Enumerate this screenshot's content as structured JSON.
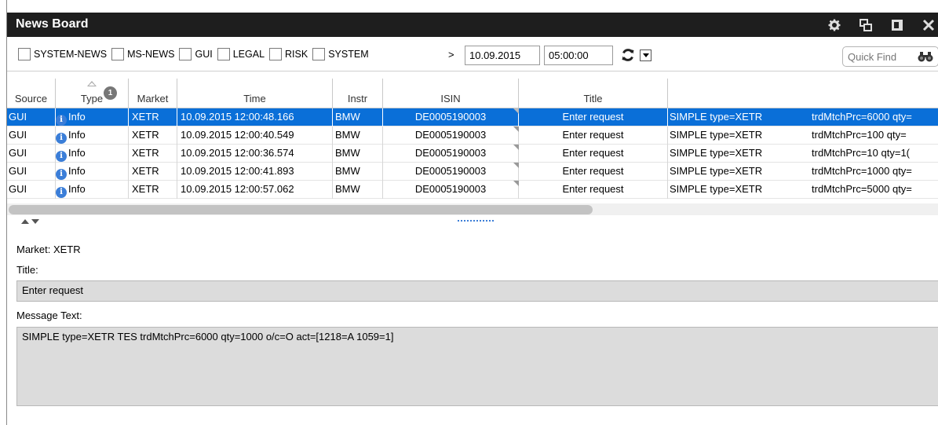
{
  "window": {
    "title": "News Board",
    "icons": [
      "gear-icon",
      "restore-window-icon",
      "detach-window-icon",
      "close-icon"
    ]
  },
  "filters": {
    "checkboxes": [
      {
        "label": "SYSTEM-NEWS",
        "checked": false
      },
      {
        "label": "MS-NEWS",
        "checked": false
      },
      {
        "label": "GUI",
        "checked": false
      },
      {
        "label": "LEGAL",
        "checked": false
      },
      {
        "label": "RISK",
        "checked": false
      },
      {
        "label": "SYSTEM",
        "checked": false
      }
    ],
    "gt": ">",
    "date": "10.09.2015",
    "time": "05:00:00",
    "quick_find_placeholder": "Quick Find"
  },
  "table": {
    "columns": [
      "Source",
      "Type",
      "Market",
      "Time",
      "Instr",
      "ISIN",
      "Title",
      "",
      ""
    ],
    "type_badge": "1",
    "rows": [
      {
        "source": "GUI",
        "type": "Info",
        "market": "XETR",
        "time": "10.09.2015 12:00:48.166",
        "instr": "BMW",
        "isin": "DE0005190003",
        "title": "Enter request",
        "text1": "SIMPLE type=XETR",
        "text2": "trdMtchPrc=6000 qty=",
        "selected": true
      },
      {
        "source": "GUI",
        "type": "Info",
        "market": "XETR",
        "time": "10.09.2015 12:00:40.549",
        "instr": "BMW",
        "isin": "DE0005190003",
        "title": "Enter request",
        "text1": "SIMPLE type=XETR",
        "text2": "trdMtchPrc=100 qty=",
        "selected": false
      },
      {
        "source": "GUI",
        "type": "Info",
        "market": "XETR",
        "time": "10.09.2015 12:00:36.574",
        "instr": "BMW",
        "isin": "DE0005190003",
        "title": "Enter request",
        "text1": "SIMPLE type=XETR",
        "text2": "trdMtchPrc=10 qty=1(",
        "selected": false
      },
      {
        "source": "GUI",
        "type": "Info",
        "market": "XETR",
        "time": "10.09.2015 12:00:41.893",
        "instr": "BMW",
        "isin": "DE0005190003",
        "title": "Enter request",
        "text1": "SIMPLE type=XETR",
        "text2": "trdMtchPrc=1000 qty=",
        "selected": false
      },
      {
        "source": "GUI",
        "type": "Info",
        "market": "XETR",
        "time": "10.09.2015 12:00:57.062",
        "instr": "BMW",
        "isin": "DE0005190003",
        "title": "Enter request",
        "text1": "SIMPLE type=XETR",
        "text2": "trdMtchPrc=5000 qty=",
        "selected": false
      }
    ]
  },
  "detail": {
    "market_line": "Market: XETR",
    "title_label": "Title:",
    "title_value": "Enter request",
    "message_label": "Message Text:",
    "message_value": "SIMPLE type=XETR   TES trdMtchPrc=6000 qty=1000 o/c=O act=[1218=A 1059=1]"
  },
  "colors": {
    "titlebar_bg": "#1e1e1e",
    "selection_bg": "#0a6fd8",
    "detail_box_bg": "#dcdcdc"
  }
}
